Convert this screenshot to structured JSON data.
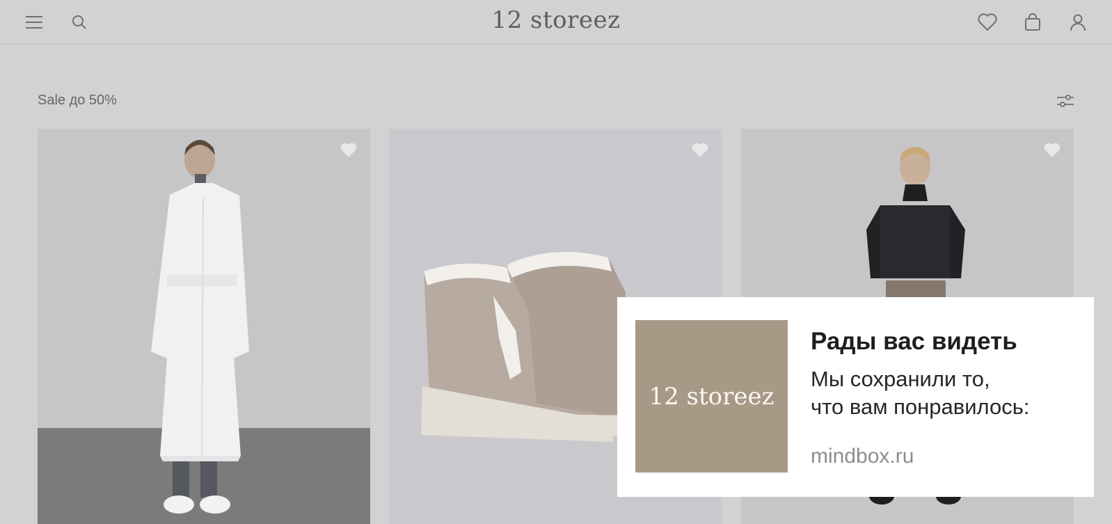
{
  "header": {
    "logo": "12 storeez",
    "icons": [
      "menu-icon",
      "search-icon",
      "heart-icon",
      "bag-icon",
      "user-icon"
    ]
  },
  "main": {
    "title": "Sale до 50%",
    "filter_icon": "sliders-icon",
    "products": [
      {
        "name": "white-belted-coat",
        "fav_icon": "heart-filled-icon"
      },
      {
        "name": "beige-fur-lined-boots",
        "fav_icon": "heart-filled-icon"
      },
      {
        "name": "black-sheer-turtleneck",
        "fav_icon": "heart-filled-icon"
      }
    ]
  },
  "popup": {
    "logo": "12 storeez",
    "title": "Рады вас видеть",
    "line1": "Мы сохранили то,",
    "line2": "что вам понравилось:",
    "domain": "mindbox.ru"
  },
  "colors": {
    "background": "#d2d2d2",
    "popup_bg": "#ffffff",
    "brand_tile": "#a89886"
  }
}
